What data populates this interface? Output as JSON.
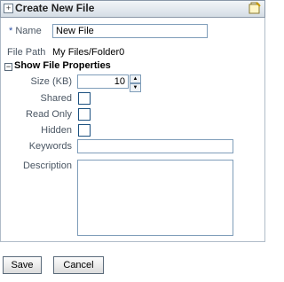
{
  "dialog": {
    "title": "Create New File",
    "expander_glyph": "+"
  },
  "form": {
    "name_required_marker": "*",
    "name_label": "Name",
    "name_value": "New File",
    "file_path_label": "File Path",
    "file_path_value": "My Files/Folder0"
  },
  "properties": {
    "toggle_glyph": "−",
    "section_title": "Show File Properties",
    "size_label": "Size (KB)",
    "size_value": "10",
    "shared_label": "Shared",
    "read_only_label": "Read Only",
    "hidden_label": "Hidden",
    "keywords_label": "Keywords",
    "keywords_value": "",
    "description_label": "Description",
    "description_value": ""
  },
  "actions": {
    "save_label": "Save",
    "cancel_label": "Cancel"
  },
  "icons": {
    "title_icon": "new-file-icon",
    "spin_up": "spin-up-icon",
    "spin_down": "spin-down-icon"
  }
}
